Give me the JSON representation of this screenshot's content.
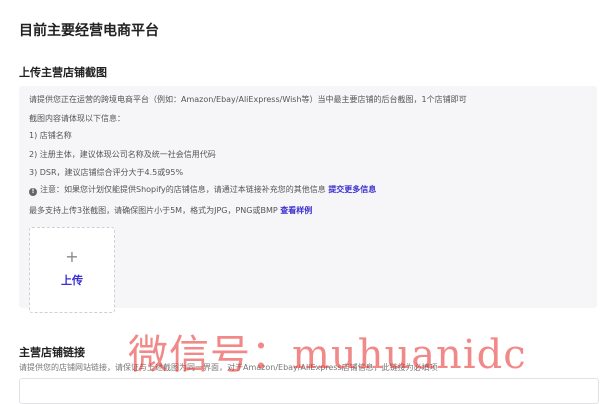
{
  "header": {
    "title": "目前主要经营电商平台"
  },
  "screenshot_section": {
    "title": "上传主营店铺截图",
    "instructions": {
      "line1": "请提供您正在运营的跨境电商平台（例如：Amazon/Ebay/AliExpress/Wish等）当中最主要店铺的后台截图，1个店铺即可",
      "line2": "截图内容请体现以下信息：",
      "item1": "1) 店铺名称",
      "item2": "2) 注册主体，建议体现公司名称及统一社会信用代码",
      "item3": "3) DSR，建议店铺综合评分大于4.5或95%",
      "note_text": "注意：如果您计划仅能提供Shopify的店铺信息，请通过本链接补充您的其他信息",
      "note_link": "提交更多信息",
      "limit_text": "最多支持上传3张截图，请确保图片小于5M，格式为JPG，PNG或BMP",
      "limit_link": "查看样例"
    },
    "upload": {
      "plus": "+",
      "label": "上传"
    }
  },
  "store_link_section": {
    "title": "主营店铺链接",
    "hint": "请提供您的店铺网站链接，请保证与上述截图为同一界面，对于Amazon/Ebay/AliExpress店铺信息，此链接为必填项"
  },
  "watermark": "微信号：muhuanidc",
  "icons": {
    "info": "info-circle-icon",
    "plus": "plus-icon"
  },
  "colors": {
    "accent": "#3a2fd0",
    "panel_bg": "#f6f6f8",
    "watermark": "#e62828"
  }
}
